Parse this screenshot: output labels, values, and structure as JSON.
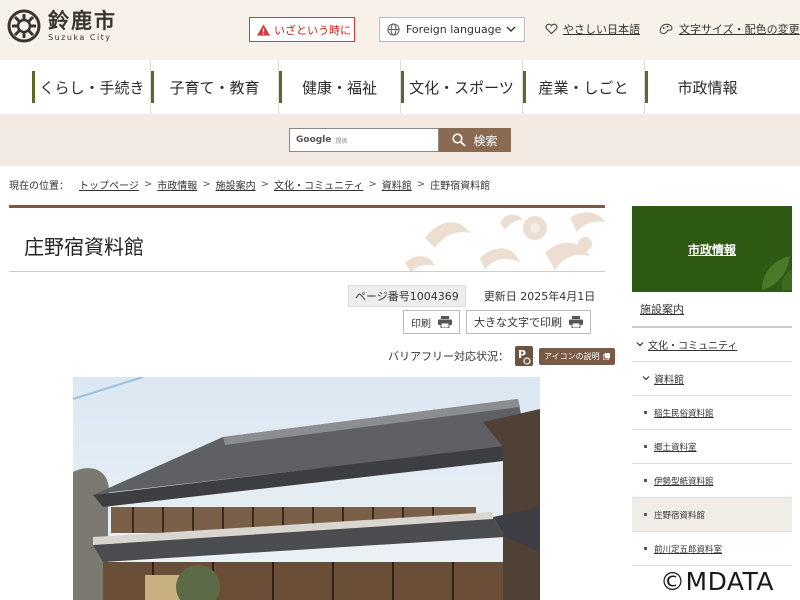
{
  "header": {
    "logo_jp": "鈴鹿市",
    "logo_en": "Suzuka City",
    "emergency_label": "いざという時に",
    "language_label": "Foreign language",
    "easy_japanese_label": "やさしい日本語",
    "font_color_label": "文字サイズ・配色の変更"
  },
  "gnav": {
    "items": [
      {
        "label": "くらし・手続き"
      },
      {
        "label": "子育て・教育"
      },
      {
        "label": "健康・福祉"
      },
      {
        "label": "文化・スポーツ"
      },
      {
        "label": "産業・しごと"
      },
      {
        "label": "市政情報"
      }
    ]
  },
  "search": {
    "google": "Google",
    "provided": "提供",
    "button_label": "検索"
  },
  "breadcrumb": {
    "prefix": "現在の位置：",
    "items": [
      "トップページ",
      "市政情報",
      "施設案内",
      "文化・コミュニティ",
      "資料館"
    ],
    "current": "庄野宿資料館"
  },
  "main": {
    "title": "庄野宿資料館",
    "page_number": "ページ番号1004369",
    "updated": "更新日 2025年4月1日",
    "print_label": "印刷",
    "large_print_label": "大きな文字で印刷",
    "barrierfree_label": "バリアフリー対応状況：",
    "icon_explain_label": "アイコンの説明"
  },
  "side": {
    "head": "市政情報",
    "items": [
      {
        "label": "施設案内"
      },
      {
        "label": "文化・コミュニティ"
      },
      {
        "label": "資料館"
      },
      {
        "label": "稲生民俗資料館"
      },
      {
        "label": "郷土資料室"
      },
      {
        "label": "伊勢型紙資料館"
      },
      {
        "label": "庄野宿資料館"
      },
      {
        "label": "前川定五郎資料室"
      }
    ]
  },
  "watermark": "©MDATA",
  "colors": {
    "brown_accent": "#7a5a44",
    "side_green": "#2f5a14",
    "emergency_red": "#d23b3b",
    "header_bg": "#f7f1ea"
  }
}
